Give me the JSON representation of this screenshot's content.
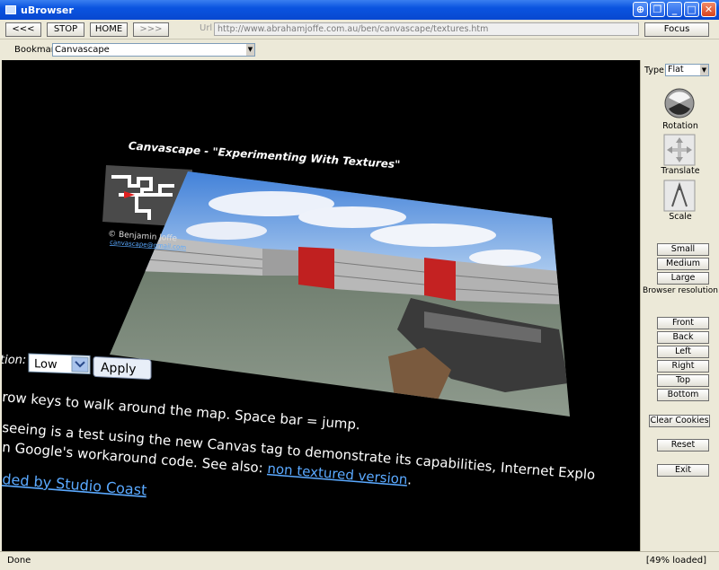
{
  "window": {
    "title": "uBrowser"
  },
  "toolbar": {
    "back_label": "<<<",
    "stop_label": "STOP",
    "home_label": "HOME",
    "forward_label": ">>>",
    "url_label": "Url",
    "url_value": "http://www.abrahamjoffe.com.au/ben/canvascape/textures.htm",
    "focus_label": "Focus"
  },
  "bookmarks": {
    "label": "Bookmarks",
    "selected": "Canvascape"
  },
  "page": {
    "title": "Canvascape - \"Experimenting With Textures\"",
    "copyright": "© Benjamin Joffe",
    "email": "canvascape@gmail.com",
    "resolution_label": "tion:",
    "resolution_value": "Low",
    "apply_label": "Apply",
    "line1": "row keys to walk around the map. Space bar = jump.",
    "line2": "seeing is a test using the new Canvas tag to demonstrate its capabilities, Internet Explo",
    "line3": "n Google's workaround code. See also: ",
    "line3_link": "non textured version",
    "line3_end": ".",
    "hosted_link": "ded by Studio Coast"
  },
  "panel": {
    "type_label": "Type",
    "type_value": "Flat",
    "rotation_label": "Rotation",
    "translate_label": "Translate",
    "scale_label": "Scale",
    "small_label": "Small",
    "medium_label": "Medium",
    "large_label": "Large",
    "browser_res_label": "Browser resolution",
    "front_label": "Front",
    "back_label": "Back",
    "left_label": "Left",
    "right_label": "Right",
    "top_label": "Top",
    "bottom_label": "Bottom",
    "clear_cookies_label": "Clear Cookies",
    "reset_label": "Reset",
    "exit_label": "Exit"
  },
  "status": {
    "left": "Done",
    "right": "[49% loaded]"
  }
}
